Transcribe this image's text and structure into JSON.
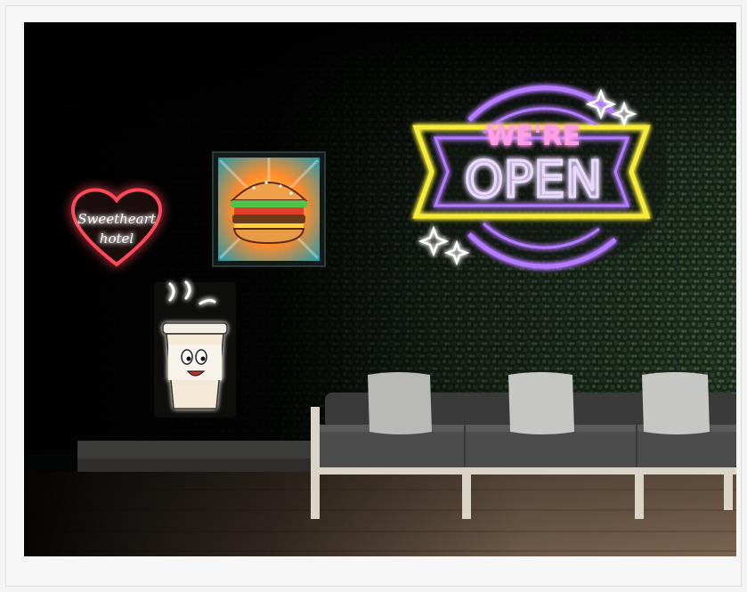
{
  "photo": {
    "subject": "neon signs on a hedge wall above an outdoor sofa",
    "signs": {
      "heart": {
        "text_line1": "Sweetheart",
        "text_line2": "hotel",
        "color": "#ff4a5a"
      },
      "open": {
        "text_top": "WE'RE",
        "text_main": "OPEN",
        "ribbon_color": "#f6ea3a",
        "ring_color": "#b57bff",
        "text_color": "#ff9ee8"
      },
      "burger": {
        "icon": "burger-icon"
      },
      "coffee": {
        "icon": "coffee-cup-icon"
      }
    }
  }
}
